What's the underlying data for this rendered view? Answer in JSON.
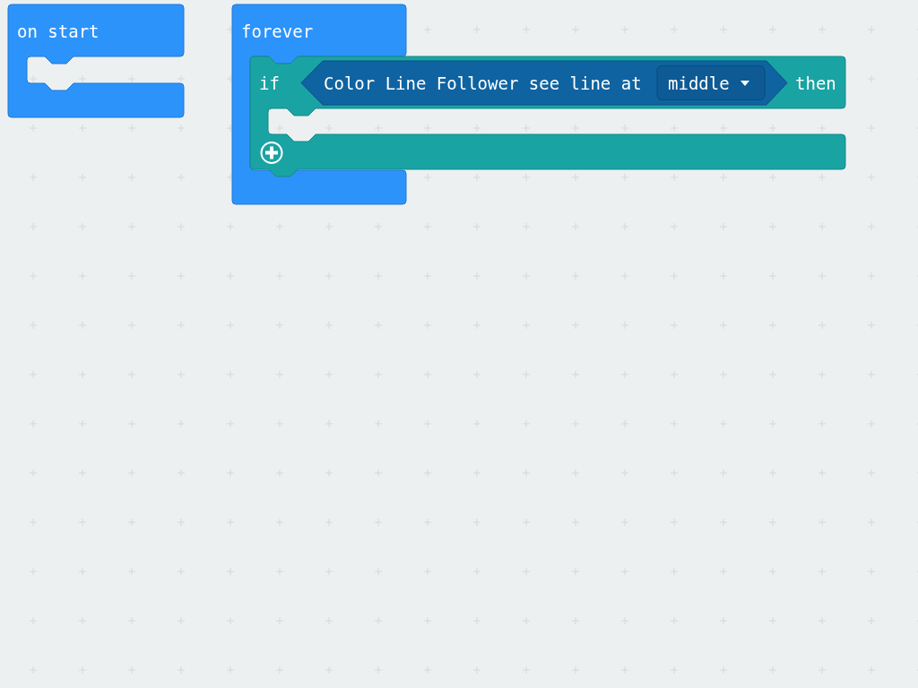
{
  "workspace": {
    "blocks": [
      {
        "kind": "event",
        "label": "on start"
      },
      {
        "kind": "loop",
        "label": "forever",
        "children": [
          {
            "kind": "if",
            "label": "if",
            "condition": {
              "text": "Color Line Follower see line at",
              "dropdown": "middle"
            },
            "then_label": "then"
          }
        ]
      }
    ]
  }
}
